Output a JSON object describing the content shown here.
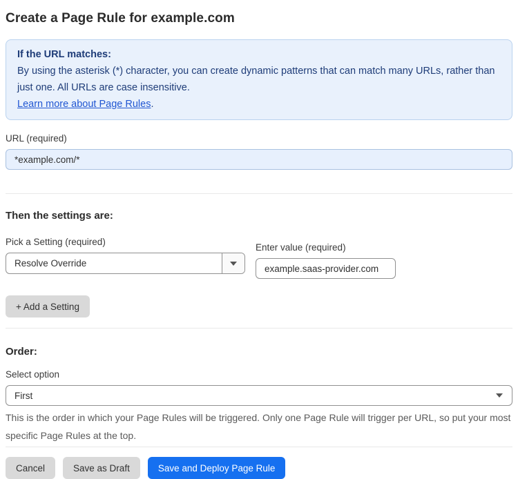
{
  "page": {
    "title": "Create a Page Rule for example.com"
  },
  "info_box": {
    "heading": "If the URL matches:",
    "body": "By using the asterisk (*) character, you can create dynamic patterns that can match many URLs, rather than just one. All URLs are case insensitive.",
    "link_label": "Learn more about Page Rules",
    "link_suffix": "."
  },
  "url_field": {
    "label": "URL (required)",
    "value": "*example.com/*"
  },
  "settings_section": {
    "heading": "Then the settings are:",
    "setting_picker": {
      "label": "Pick a Setting (required)",
      "selected": "Resolve Override"
    },
    "value_field": {
      "label": "Enter value (required)",
      "value": "example.saas-provider.com"
    },
    "add_setting_button": "+ Add a Setting"
  },
  "order_section": {
    "heading": "Order:",
    "select_label": "Select option",
    "selected": "First",
    "help_text": "This is the order in which your Page Rules will be triggered. Only one Page Rule will trigger per URL, so put your most specific Page Rules at the top."
  },
  "footer": {
    "cancel_label": "Cancel",
    "save_draft_label": "Save as Draft",
    "save_deploy_label": "Save and Deploy Page Rule"
  },
  "colors": {
    "accent_blue": "#1670f0",
    "info_background": "#e9f1fc",
    "info_border": "#b9d2ef",
    "info_text": "#1e3c78",
    "link_blue": "#2056d2",
    "url_input_background": "#e7f0fd",
    "gray_button": "#d9d9d9"
  }
}
